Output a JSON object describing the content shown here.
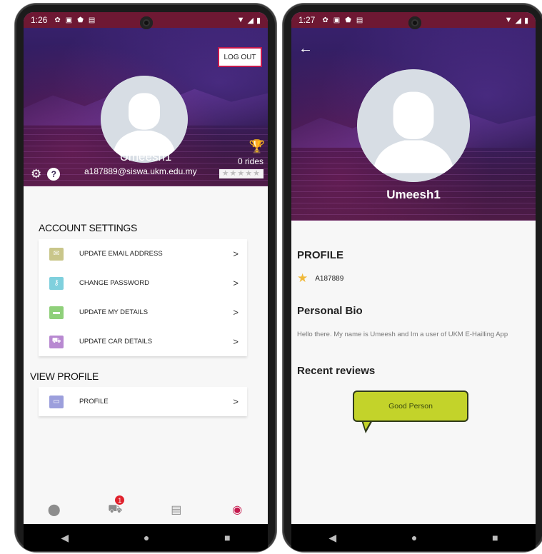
{
  "left_screen": {
    "status_bar": {
      "time": "1:26"
    },
    "header": {
      "logout_label": "LOG OUT",
      "username": "Umeesh1",
      "email": "a187889@siswa.ukm.edu.my",
      "rides": "0 rides",
      "rating_stars": "★★★★★",
      "help_glyph": "?"
    },
    "account_settings": {
      "title": "ACCOUNT SETTINGS",
      "items": [
        {
          "label": "UPDATE EMAIL ADDRESS",
          "icon": "email-icon",
          "icon_color": "#c9c68a"
        },
        {
          "label": "CHANGE PASSWORD",
          "icon": "key-icon",
          "icon_color": "#7fd0dd"
        },
        {
          "label": "UPDATE MY DETAILS",
          "icon": "folder-icon",
          "icon_color": "#8fd07a"
        },
        {
          "label": "UPDATE CAR DETAILS",
          "icon": "car-icon",
          "icon_color": "#b889d1"
        }
      ]
    },
    "view_profile": {
      "title": "VIEW PROFILE",
      "items": [
        {
          "label": "PROFILE",
          "icon": "card-icon",
          "icon_color": "#9c9fdc"
        }
      ]
    },
    "bottom_nav": {
      "badge_count": "1",
      "active_color": "#c5194d"
    }
  },
  "right_screen": {
    "status_bar": {
      "time": "1:27"
    },
    "header": {
      "username": "Umeesh1"
    },
    "profile_title": "PROFILE",
    "matric_id": "A187889",
    "bio_title": "Personal Bio",
    "bio_text": "Hello there. My name is Umeesh and Im a user of UKM E-Hailling App",
    "reviews_title": "Recent reviews",
    "review_text": "Good Person"
  },
  "colors": {
    "status_bar": "#6e1833",
    "accent": "#c5194d",
    "review_bubble": "#c3d32a"
  }
}
